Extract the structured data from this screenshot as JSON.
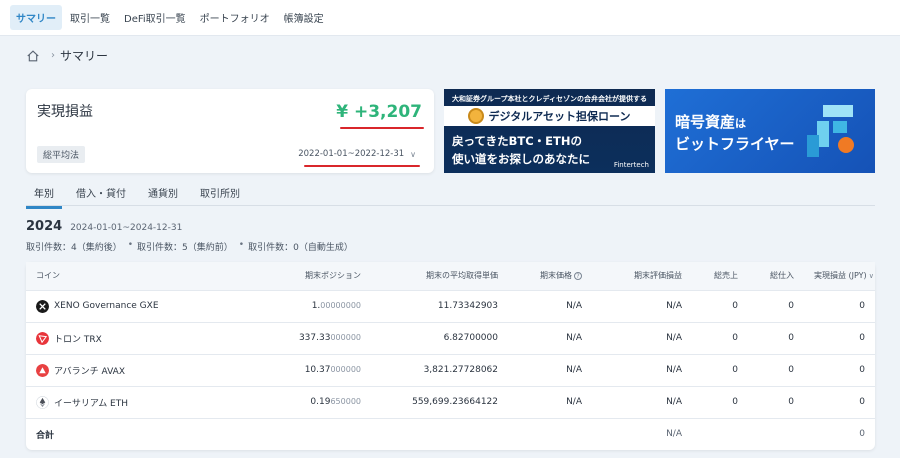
{
  "topnav": {
    "tabs": [
      {
        "label": "サマリー",
        "active": true
      },
      {
        "label": "取引一覧"
      },
      {
        "label": "DeFi取引一覧"
      },
      {
        "label": "ポートフォリオ"
      },
      {
        "label": "帳簿設定"
      }
    ]
  },
  "breadcrumb": {
    "home_icon": "home-icon",
    "separator": "›",
    "current": "サマリー"
  },
  "pl_card": {
    "title": "実現損益",
    "value": "¥ +3,207",
    "method": "総平均法",
    "date_range": "2022-01-01~2022-12-31",
    "value_color": "#2eb47a",
    "highlight_color": "#d9262b"
  },
  "banner1": {
    "top": "大和証券グループ本社とクレディセゾンの合弁会社が提供する",
    "strip": "デジタルアセット担保ローン",
    "line1": "戻ってきたBTC・ETHの",
    "line2": "使い道をお探しのあなたに",
    "logo": "Fintertech"
  },
  "banner2": {
    "line1_main": "暗号資産",
    "line1_small": "は",
    "line2": "ビットフライヤー"
  },
  "subtabs": [
    {
      "label": "年別",
      "active": true
    },
    {
      "label": "借入・貸付"
    },
    {
      "label": "通貨別"
    },
    {
      "label": "取引所別"
    }
  ],
  "summary": {
    "year": "2024",
    "range": "2024-01-01~2024-12-31",
    "counts": [
      "取引件数：4（集約後）",
      "取引件数：5（集約前）",
      "取引件数：0（自動生成）"
    ]
  },
  "table": {
    "headers": {
      "coin": "コイン",
      "position": "期末ポジション",
      "avg_cost": "期末の平均取得単価",
      "price": "期末価格",
      "eval_pl": "期末評価損益",
      "total_sales": "総売上",
      "total_purchase": "総仕入",
      "realized_pl": "実現損益 (JPY)"
    },
    "rows": [
      {
        "name": "XENO Governance GXE",
        "icon": "xeno-icon",
        "icon_color": "#1a1a1a",
        "pos_main": "1.",
        "pos_dim": "00000000",
        "avg": "11.73342903",
        "price": "N/A",
        "eval": "N/A",
        "sales": "0",
        "purchase": "0",
        "realized": "0"
      },
      {
        "name": "トロン TRX",
        "icon": "tron-icon",
        "icon_color": "#e8353b",
        "pos_main": "337.33",
        "pos_dim": "000000",
        "avg": "6.82700000",
        "price": "N/A",
        "eval": "N/A",
        "sales": "0",
        "purchase": "0",
        "realized": "0"
      },
      {
        "name": "アバランチ AVAX",
        "icon": "avalanche-icon",
        "icon_color": "#e84142",
        "pos_main": "10.37",
        "pos_dim": "000000",
        "avg": "3,821.27728062",
        "price": "N/A",
        "eval": "N/A",
        "sales": "0",
        "purchase": "0",
        "realized": "0"
      },
      {
        "name": "イーサリアム ETH",
        "icon": "ethereum-icon",
        "icon_color": "#ffffff",
        "pos_main": "0.19",
        "pos_dim": "650000",
        "avg": "559,699.23664122",
        "price": "N/A",
        "eval": "N/A",
        "sales": "0",
        "purchase": "0",
        "realized": "0"
      }
    ],
    "total": {
      "label": "合計",
      "eval": "N/A",
      "realized": "0"
    }
  }
}
